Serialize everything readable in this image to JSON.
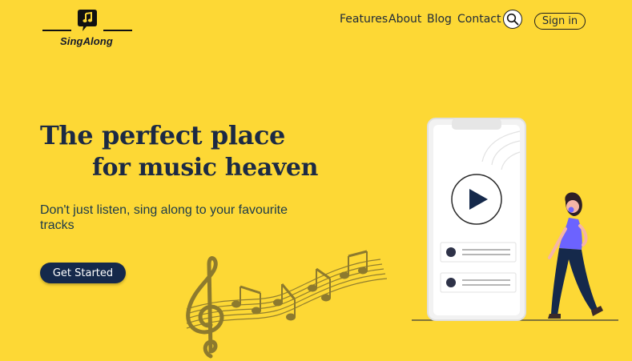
{
  "brand": {
    "name": "SingAlong"
  },
  "nav": {
    "items": [
      "Features",
      "About",
      "Blog",
      "Contact"
    ],
    "signin_label": "Sign in"
  },
  "hero": {
    "title_line1": "The perfect place",
    "title_line2": "for music heaven",
    "subtitle": "Don't just listen, sing along to your favourite tracks",
    "cta_label": "Get Started"
  },
  "colors": {
    "background": "#FDD835",
    "primary_dark": "#15294b",
    "heading": "#1c2a44",
    "accent_purple": "#6c63ff",
    "notes": "#8d7a2e"
  },
  "icons": {
    "logo": "speech-bubble-music-note-icon",
    "search": "search-icon",
    "play": "play-icon"
  }
}
